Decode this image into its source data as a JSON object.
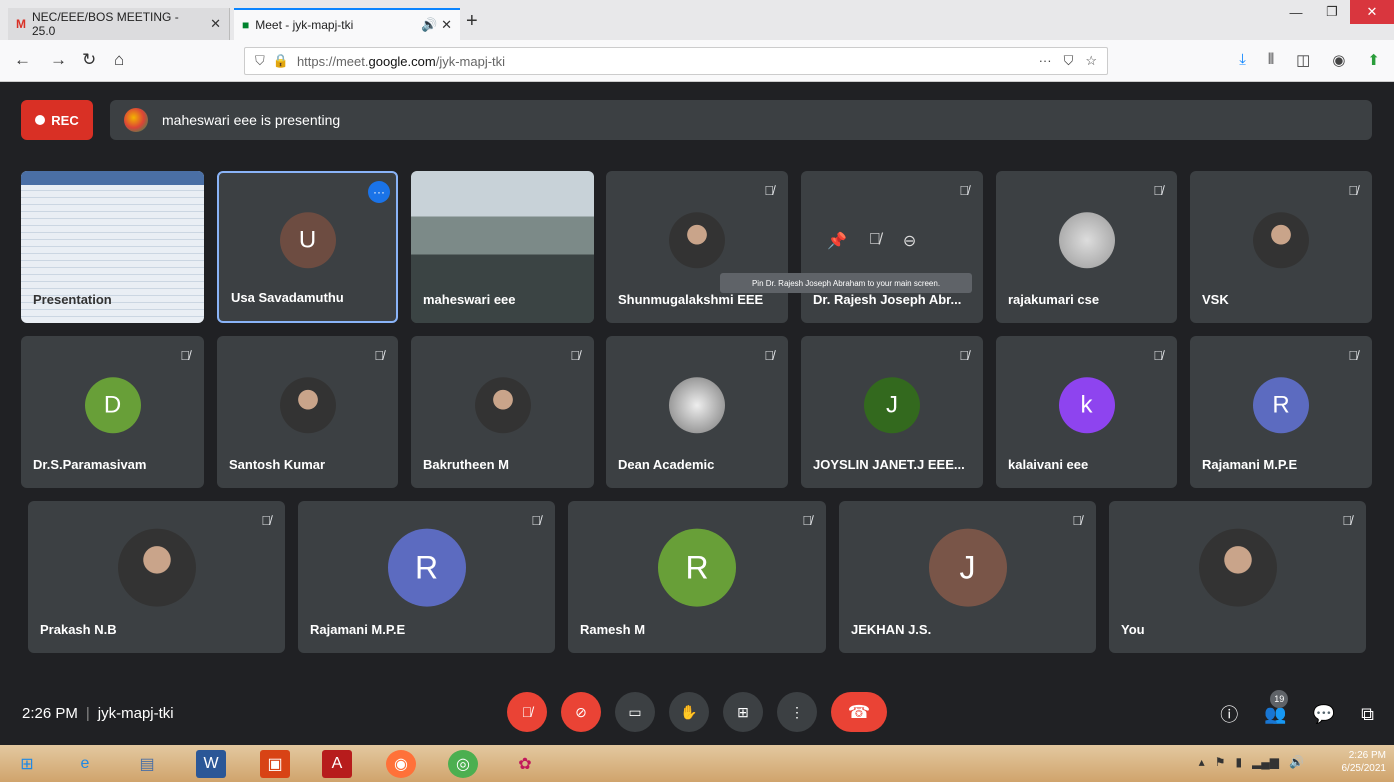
{
  "browser": {
    "tabs": [
      {
        "label": "NEC/EEE/BOS MEETING - 25.0"
      },
      {
        "label": "Meet - jyk-mapj-tki"
      }
    ],
    "url_prefix": "https://meet.",
    "url_domain": "google.com",
    "url_path": "/jyk-mapj-tki"
  },
  "meet": {
    "rec_label": "REC",
    "presenting_text": "maheswari eee is presenting",
    "tiles": [
      {
        "name": "Presentation",
        "initial": ""
      },
      {
        "name": "Usa Savadamuthu",
        "initial": "U",
        "color": "#6d4c41"
      },
      {
        "name": "maheswari eee",
        "initial": ""
      },
      {
        "name": "Shunmugalakshmi EEE",
        "initial": ""
      },
      {
        "name": "Dr. Rajesh Joseph Abr...",
        "initial": ""
      },
      {
        "name": "rajakumari cse",
        "initial": ""
      },
      {
        "name": "VSK",
        "initial": ""
      },
      {
        "name": "Dr.S.Paramasivam",
        "initial": "D",
        "color": "#689f38"
      },
      {
        "name": "Santosh Kumar",
        "initial": ""
      },
      {
        "name": "Bakrutheen M",
        "initial": ""
      },
      {
        "name": "Dean Academic",
        "initial": ""
      },
      {
        "name": "JOYSLIN JANET.J EEE...",
        "initial": "J",
        "color": "#33691e"
      },
      {
        "name": "kalaivani eee",
        "initial": "k",
        "color": "#8e44ef"
      },
      {
        "name": "Rajamani M.P.E",
        "initial": "R",
        "color": "#5c6bc0"
      },
      {
        "name": "Prakash N.B",
        "initial": ""
      },
      {
        "name": "Rajamani M.P.E",
        "initial": "R",
        "color": "#5c6bc0"
      },
      {
        "name": "Ramesh M",
        "initial": "R",
        "color": "#689f38"
      },
      {
        "name": "JEKHAN J.S.",
        "initial": "J",
        "color": "#795548"
      },
      {
        "name": "You",
        "initial": ""
      }
    ],
    "tooltip": "Pin Dr. Rajesh Joseph Abraham to your main screen.",
    "time": "2:26 PM",
    "meeting_code": "jyk-mapj-tki",
    "participant_count": "19"
  },
  "taskbar": {
    "time": "2:26 PM",
    "date": "6/25/2021"
  }
}
